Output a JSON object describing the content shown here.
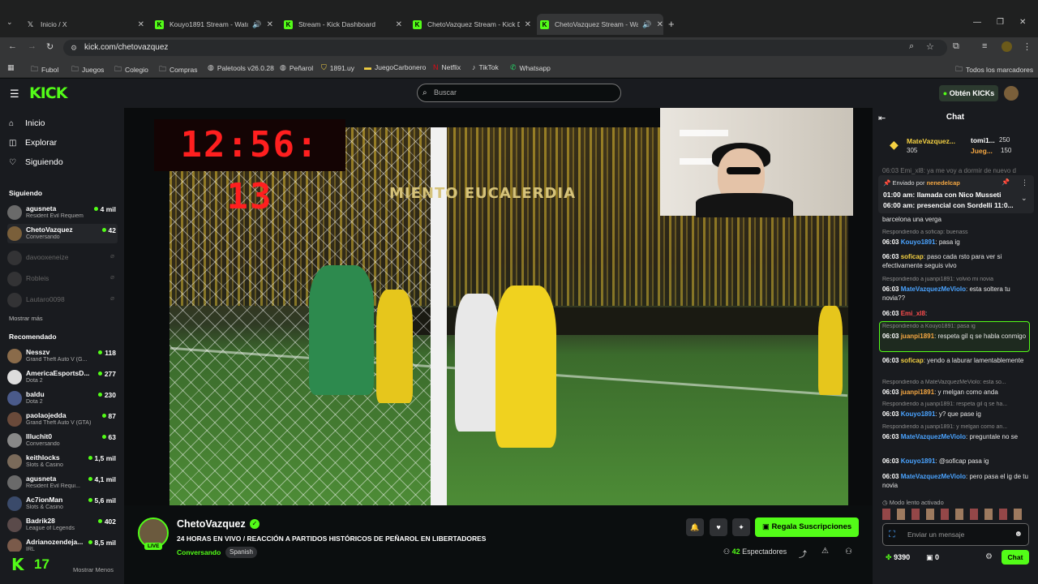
{
  "browser": {
    "tabs": [
      {
        "title": "Inicio / X",
        "favicon": "X"
      },
      {
        "title": "Kouyo1891 Stream - Watch",
        "favicon": "K"
      },
      {
        "title": "Stream - Kick Dashboard",
        "favicon": "K"
      },
      {
        "title": "ChetoVazquez Stream - Kick Da",
        "favicon": "K"
      },
      {
        "title": "ChetoVazquez Stream - Wa",
        "favicon": "K"
      }
    ],
    "url": "kick.com/chetovazquez",
    "bookmarks": [
      "Fubol",
      "Juegos",
      "Colegio",
      "Compras",
      "Paletools v26.0.28",
      "Peñarol",
      "1891.uy",
      "JuegoCarbonero",
      "Netflix",
      "TikTok",
      "Whatsapp"
    ],
    "all_bookmarks": "Todos los marcadores"
  },
  "header": {
    "logo": "KICK",
    "search_placeholder": "Buscar",
    "get_kicks": "Obtén KICKs"
  },
  "sidebar": {
    "nav": [
      "Inicio",
      "Explorar",
      "Siguiendo"
    ],
    "following_title": "Siguiendo",
    "following": [
      {
        "name": "agusneta",
        "game": "Resident Evil Requiem",
        "viewers": "4 mil",
        "live": true
      },
      {
        "name": "ChetoVazquez",
        "game": "Conversando",
        "viewers": "42",
        "live": true
      },
      {
        "name": "davooxeneize",
        "game": "",
        "viewers": "",
        "live": false
      },
      {
        "name": "Robleis",
        "game": "",
        "viewers": "",
        "live": false
      },
      {
        "name": "Lautaro0098",
        "game": "",
        "viewers": "",
        "live": false
      }
    ],
    "show_more": "Mostrar más",
    "recommended_title": "Recomendado",
    "recommended": [
      {
        "name": "Nesszv",
        "game": "Grand Theft Auto V (G...",
        "viewers": "118"
      },
      {
        "name": "AmericaEsportsD...",
        "game": "Dota 2",
        "viewers": "277"
      },
      {
        "name": "baldu",
        "game": "Dota 2",
        "viewers": "230"
      },
      {
        "name": "paolaojedda",
        "game": "Grand Theft Auto V (GTA)",
        "viewers": "87"
      },
      {
        "name": "Illuchit0",
        "game": "Conversando",
        "viewers": "63"
      },
      {
        "name": "keithlocks",
        "game": "Slots & Casino",
        "viewers": "1,5 mil"
      },
      {
        "name": "agusneta",
        "game": "Resident Evil Requi...",
        "viewers": "4,1 mil"
      },
      {
        "name": "Ac7ionMan",
        "game": "Slots & Casino",
        "viewers": "5,6 mil"
      },
      {
        "name": "Badrik28",
        "game": "League of Legends",
        "viewers": "402"
      },
      {
        "name": "Adrianozendeja...",
        "game": "IRL",
        "viewers": "8,5 mil"
      }
    ],
    "show_less": "Mostrar Menos",
    "badge_number": "17"
  },
  "video": {
    "timer": "12:56: 13",
    "banner": "MIENTO  EUCALERDIA"
  },
  "stream": {
    "name": "ChetoVazquez",
    "title": "24 HORAS EN VIVO / REACCIÓN A PARTIDOS HISTÓRICOS DE PEÑAROL EN LIBERTADORES",
    "category": "Conversando",
    "language": "Spanish",
    "live": "LIVE",
    "subscribe": "Regala Suscripciones",
    "viewers_count": "42",
    "viewers_label": "Espectadores"
  },
  "chat": {
    "title": "Chat",
    "leaderboard": [
      {
        "name": "MateVazquez...",
        "value": "305"
      },
      {
        "name": "tomi1...",
        "value": "250"
      },
      {
        "name": "Jueg...",
        "value": "150"
      }
    ],
    "partial_top": "06:03  Emi_xl8: ya me voy a dormir de nuevo d",
    "pinned": {
      "by_label": "Enviado por",
      "by_user": "nenedelcap",
      "line1": "01:00 am: llamada con Nico Musseti",
      "line2": "06:00 am: presencial con Sordelli 11:0..."
    },
    "messages": [
      {
        "reply": "",
        "time": "",
        "user": "",
        "text": "barcelona una verga",
        "color": "#e6e6e6"
      },
      {
        "reply": "Respondiendo a soficap: buenass",
        "time": "06:03",
        "user": "Kouyo1891",
        "text": "pasa ig",
        "color": "#4aa3ff"
      },
      {
        "reply": "",
        "time": "06:03",
        "user": "soficap",
        "text": "paso cada rsto para ver si efectivamente seguis vivo",
        "color": "#f5d142"
      },
      {
        "reply": "Respondiendo a juanpi1891: volvió mi novia",
        "time": "06:03",
        "user": "MateVazquezMeViolo",
        "text": "esta soltera tu novia??",
        "color": "#4aa3ff"
      },
      {
        "reply": "",
        "time": "06:03",
        "user": "Emi_xl8",
        "text": "",
        "color": "#ff4d4d"
      },
      {
        "reply": "Respondiendo a Kouyo1891: pasa ig",
        "time": "06:03",
        "user": "juanpi1891",
        "text": "respeta gil q se habla conmigo",
        "color": "#f5a742"
      },
      {
        "reply": "",
        "time": "06:03",
        "user": "soficap",
        "text": "yendo a laburar lamentablemente",
        "color": "#f5d142"
      },
      {
        "reply": "Respondiendo a MateVazquezMeViolo: esta so...",
        "time": "06:03",
        "user": "juanpi1891",
        "text": "y melgan como anda",
        "color": "#f5a742"
      },
      {
        "reply": "Respondiendo a juanpi1891: respeta gil q se ha...",
        "time": "06:03",
        "user": "Kouyo1891",
        "text": "y? que pase ig",
        "color": "#4aa3ff"
      },
      {
        "reply": "Respondiendo a juanpi1891: y melgan como an...",
        "time": "06:03",
        "user": "MateVazquezMeViolo",
        "text": "preguntale no se",
        "color": "#4aa3ff"
      },
      {
        "reply": "",
        "time": "06:03",
        "user": "Kouyo1891",
        "text": "@soficap pasa ig",
        "color": "#4aa3ff"
      },
      {
        "reply": "",
        "time": "06:03",
        "user": "MateVazquezMeViolo",
        "text": "pero pasa el ig de tu novia",
        "color": "#4aa3ff"
      }
    ],
    "slow_mode": "Modo lento activado",
    "input_placeholder": "Enviar un mensaje",
    "kicks_balance": "9390",
    "gifts_count": "0",
    "send_label": "Chat"
  },
  "colors": {
    "accent": "#53fc18",
    "bg": "#0b0e0f",
    "panel": "#191b1f"
  }
}
